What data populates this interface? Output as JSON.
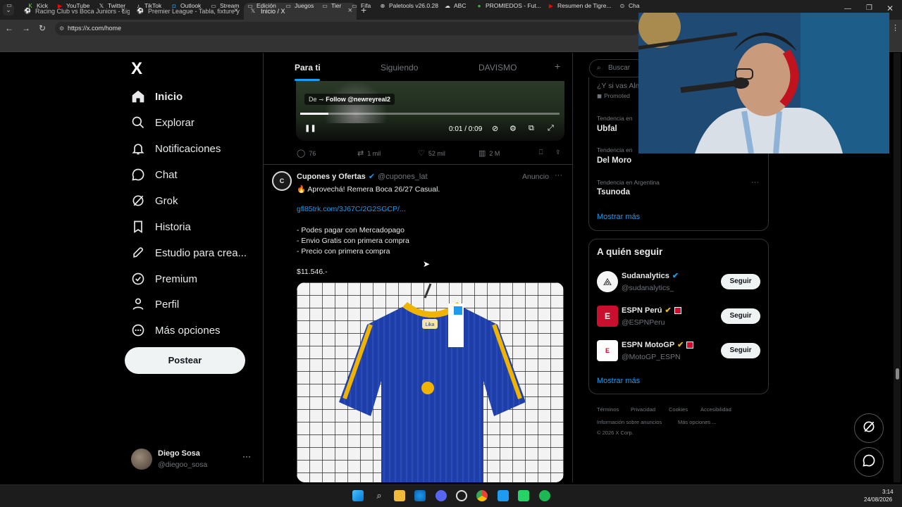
{
  "browser": {
    "tabs": [
      {
        "label": "Racing Club vs Boca Juniors - Lig",
        "icon": "soccer-icon"
      },
      {
        "label": "Premier League - Tabla, fixture y",
        "icon": "soccer-icon"
      },
      {
        "label": "Inicio / X",
        "icon": "x-logo-icon"
      }
    ],
    "url": "https://x.com/home",
    "bookmarks": [
      "Kick",
      "YouTube",
      "Twitter",
      "TikTok",
      "Outlook",
      "Stream",
      "Edición",
      "Juegos",
      "Tier",
      "Fifa",
      "Paletools v26.0.28",
      "ABC",
      "PROMIEDOS - Fut...",
      "Resumen de Tigre...",
      "Cha"
    ]
  },
  "sidebar": {
    "logo": "X",
    "items": [
      {
        "label": "Inicio",
        "icon": "home-icon"
      },
      {
        "label": "Explorar",
        "icon": "search-icon"
      },
      {
        "label": "Notificaciones",
        "icon": "bell-icon"
      },
      {
        "label": "Chat",
        "icon": "chat-icon"
      },
      {
        "label": "Grok",
        "icon": "grok-icon"
      },
      {
        "label": "Historia",
        "icon": "bookmark-icon"
      },
      {
        "label": "Estudio para crea...",
        "icon": "rocket-icon"
      },
      {
        "label": "Premium",
        "icon": "verified-icon"
      },
      {
        "label": "Perfil",
        "icon": "person-icon"
      },
      {
        "label": "Más opciones",
        "icon": "more-circle-icon"
      }
    ],
    "post_button": "Postear",
    "user": {
      "name": "Diego Sosa",
      "handle": "@diegoo_sosa",
      "more": "···"
    }
  },
  "feed": {
    "tabs": [
      "Para ti",
      "Siguiendo",
      "DAVISMO"
    ],
    "add_tab": "+",
    "video": {
      "overlay_prefix": "De",
      "overlay_text": "Follow @newreyreal2",
      "time": "0:01 / 0:09",
      "progress": 0.11
    },
    "video_actions": {
      "replies": "76",
      "reposts": "1 mil",
      "likes": "52 mil",
      "views": "2 M"
    },
    "ad_post": {
      "name": "Cupones y Ofertas",
      "handle": "@cupones_lat",
      "ad_label": "Anuncio",
      "more": "···",
      "line1": "🔥 Aprovechá! Remera Boca 26/27 Casual.",
      "link": "gfl85trk.com/3J67C/2G2SGCP/...",
      "bullets": [
        "- Podes pagar con Mercadopago",
        "- Envio Gratis con primera compra",
        "- Precio con primera compra"
      ],
      "price": "$11.546.-",
      "shirt_brand": "Lika"
    }
  },
  "right": {
    "search_placeholder": "Buscar",
    "promoted": {
      "title": "¿Y si vas Alm",
      "label": "Promoted"
    },
    "trends": [
      {
        "context": "Tendencia en",
        "name": "Ubfal"
      },
      {
        "context": "Tendencia en",
        "name": "Del Moro"
      },
      {
        "context": "Tendencia en Argentina",
        "name": "Tsunoda"
      }
    ],
    "trend_more": "···",
    "show_more": "Mostrar más",
    "follow_title": "A quién seguir",
    "follow": [
      {
        "name": "Sudanalytics",
        "handle": "@sudanalytics_",
        "button": "Seguir"
      },
      {
        "name": "ESPN Perú",
        "handle": "@ESPNPeru",
        "button": "Seguir"
      },
      {
        "name": "ESPN MotoGP",
        "handle": "@MotoGP_ESPN",
        "button": "Seguir"
      }
    ],
    "follow_more": "Mostrar más",
    "footer": [
      "Términos",
      "Privacidad",
      "Cookies",
      "Accesibilidad",
      "Información sobre anuncios",
      "Más opciones ...",
      "© 2026 X Corp."
    ]
  },
  "taskbar": {
    "time": "3:14",
    "date": "24/08/2026"
  },
  "colors": {
    "accent": "#1d9bf0",
    "background": "#000000",
    "border": "#2f3336",
    "muted": "#71767b"
  }
}
